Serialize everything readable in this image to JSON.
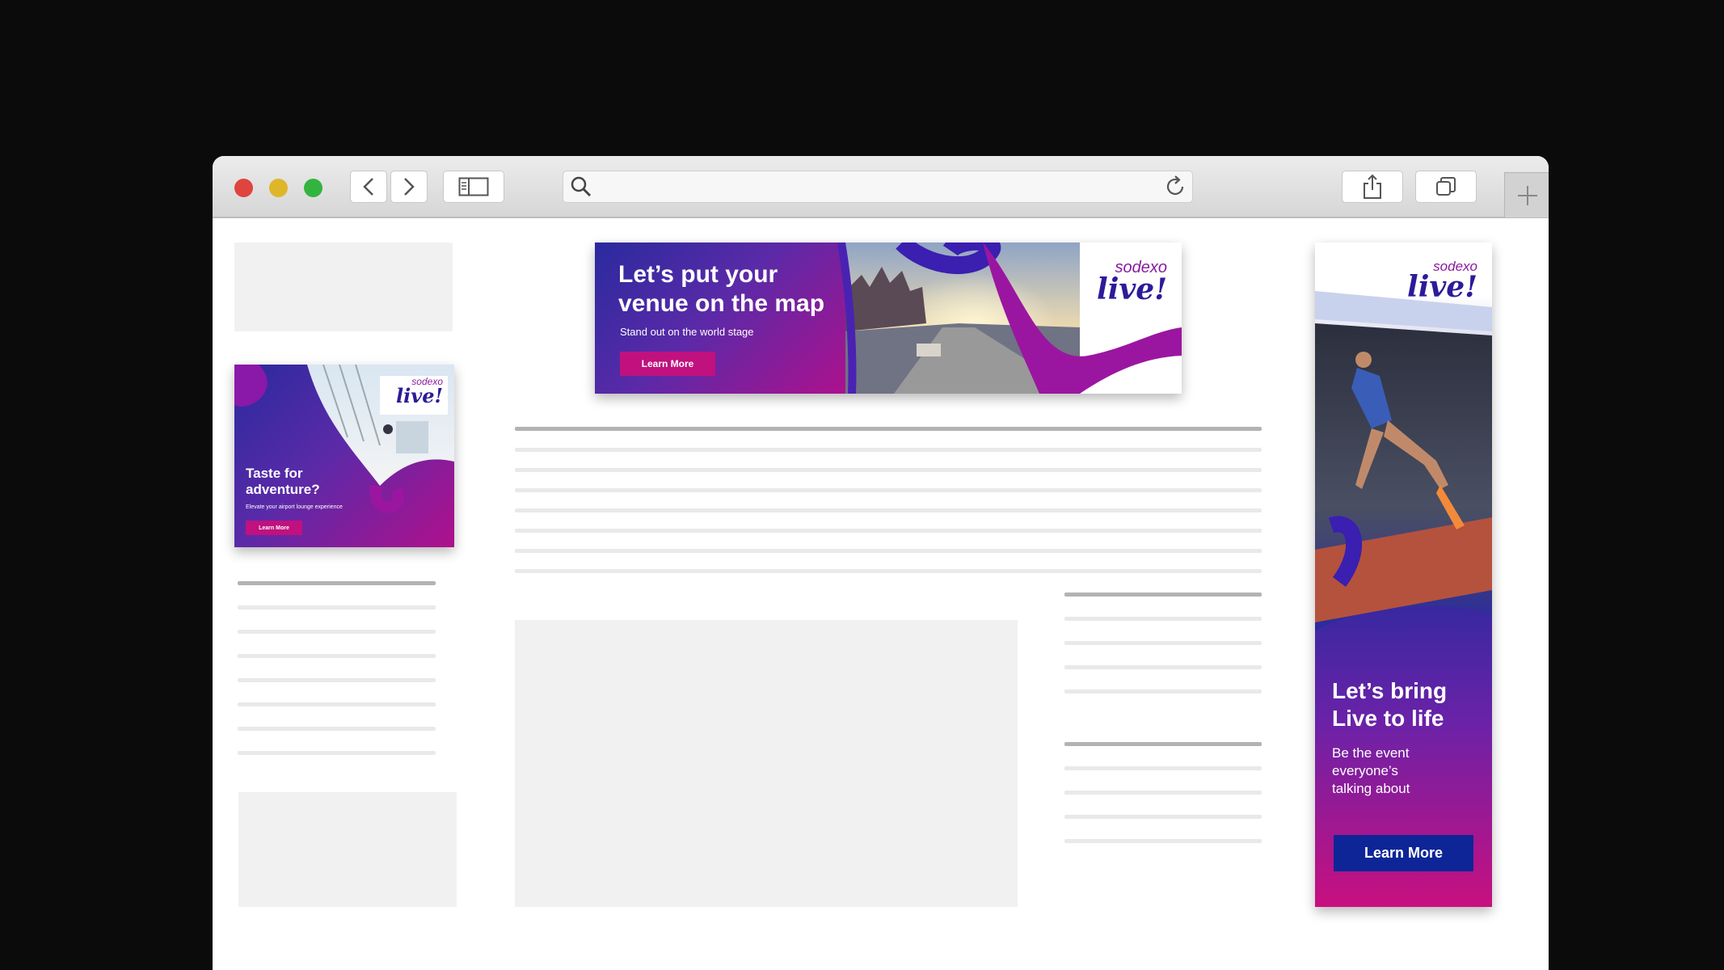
{
  "toolbar": {
    "traffic_lights": {
      "close": "#e0443e",
      "minimize": "#dfb62a",
      "maximize": "#33b43f"
    },
    "icons": [
      "back-icon",
      "forward-icon",
      "sidebar-icon",
      "search-icon",
      "reload-icon",
      "share-icon",
      "tabs-icon",
      "new-tab-icon"
    ]
  },
  "ads": {
    "banner": {
      "headline_1": "Let’s put your",
      "headline_2": "venue on the map",
      "subtext": "Stand out on the world stage",
      "cta": "Learn More",
      "logo_top": "sodexo",
      "logo_bottom": "live!"
    },
    "square": {
      "headline_1": "Taste for",
      "headline_2": "adventure?",
      "subtext": "Elevate your airport lounge experience",
      "cta": "Learn More",
      "logo_top": "sodexo",
      "logo_bottom": "live!"
    },
    "skyscraper": {
      "headline_1": "Let’s bring",
      "headline_2": "Live to life",
      "sub_1": "Be the event",
      "sub_2": "everyone’s",
      "sub_3": "talking about",
      "cta": "Learn More",
      "logo_top": "sodexo",
      "logo_bottom": "live!"
    }
  },
  "colors": {
    "brand_purple": "#3b1fa0",
    "brand_magenta": "#c0117f",
    "navy_button": "#0d2596"
  }
}
